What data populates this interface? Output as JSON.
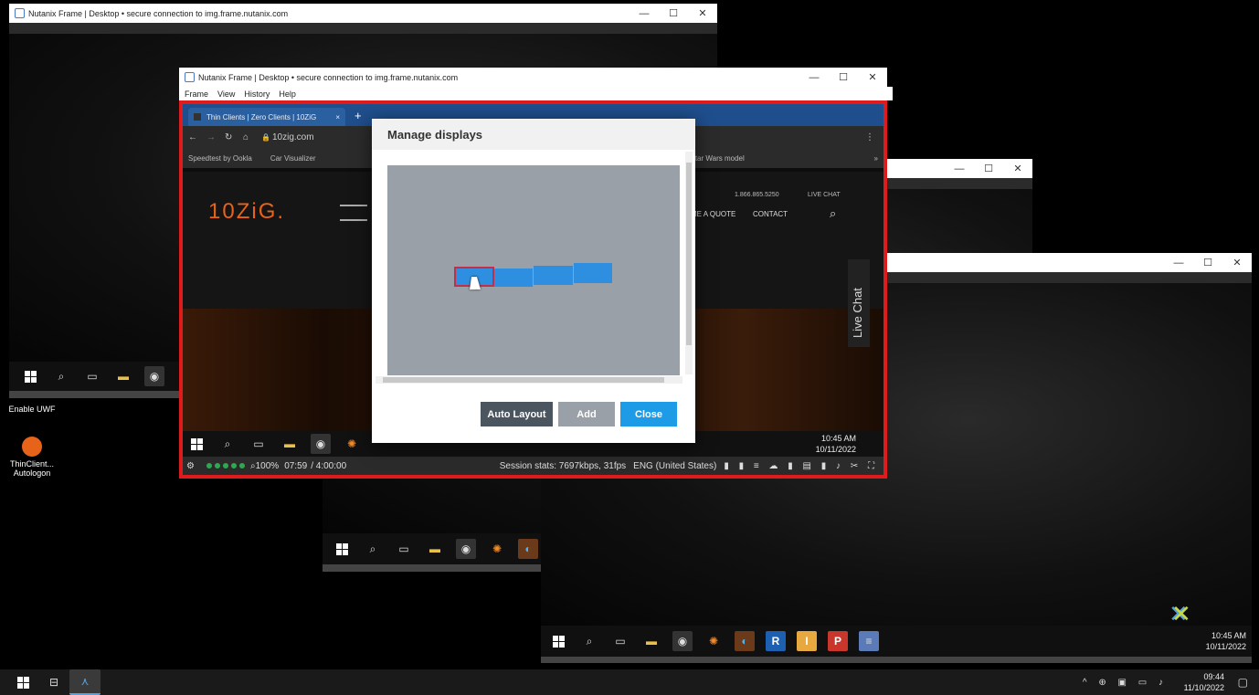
{
  "window_title": "Nutanix Frame | Desktop • secure connection to img.frame.nutanix.com",
  "win_ctrls": {
    "min": "—",
    "max": "☐",
    "close": "✕"
  },
  "menu": [
    "Frame",
    "View",
    "History",
    "Help"
  ],
  "browser": {
    "tab_title": "Thin Clients | Zero Clients | 10ZiG",
    "tab_close": "×",
    "new_tab": "+",
    "url": "10zig.com",
    "bookmarks": [
      "Speedtest by Ookla",
      "Car Visualizer",
      "Star Wars model"
    ],
    "bookmark_more": "»"
  },
  "site": {
    "logo": "10ZiG.",
    "phone": "1.866.865.5250",
    "live_chat_top": "LIVE CHAT",
    "nav": [
      "ME A QUOTE",
      "CONTACT"
    ],
    "live_chat_side": "Live Chat"
  },
  "dialog": {
    "title": "Manage displays",
    "buttons": {
      "auto_layout": "Auto Layout",
      "add": "Add",
      "close": "Close"
    }
  },
  "status": {
    "zoom": "100%",
    "time": "07:59",
    "duration": "/ 4:00:00",
    "stats": "Session stats: 7697kbps, 31fps",
    "lang": "ENG (United States)"
  },
  "remote_clock": {
    "time": "10:45 AM",
    "date": "10/11/2022"
  },
  "desktop_icons": [
    {
      "label": "Enable UWF"
    },
    {
      "label": "ThinClient... Autologon"
    }
  ],
  "host_clock": {
    "time": "09:44",
    "date": "11/10/2022"
  },
  "colors": {
    "accent_blue": "#2e8fe0",
    "red_border": "#e01b1b",
    "close_btn": "#1e9be6",
    "auto_btn": "#4a5560",
    "add_btn": "#9aa0a8"
  }
}
